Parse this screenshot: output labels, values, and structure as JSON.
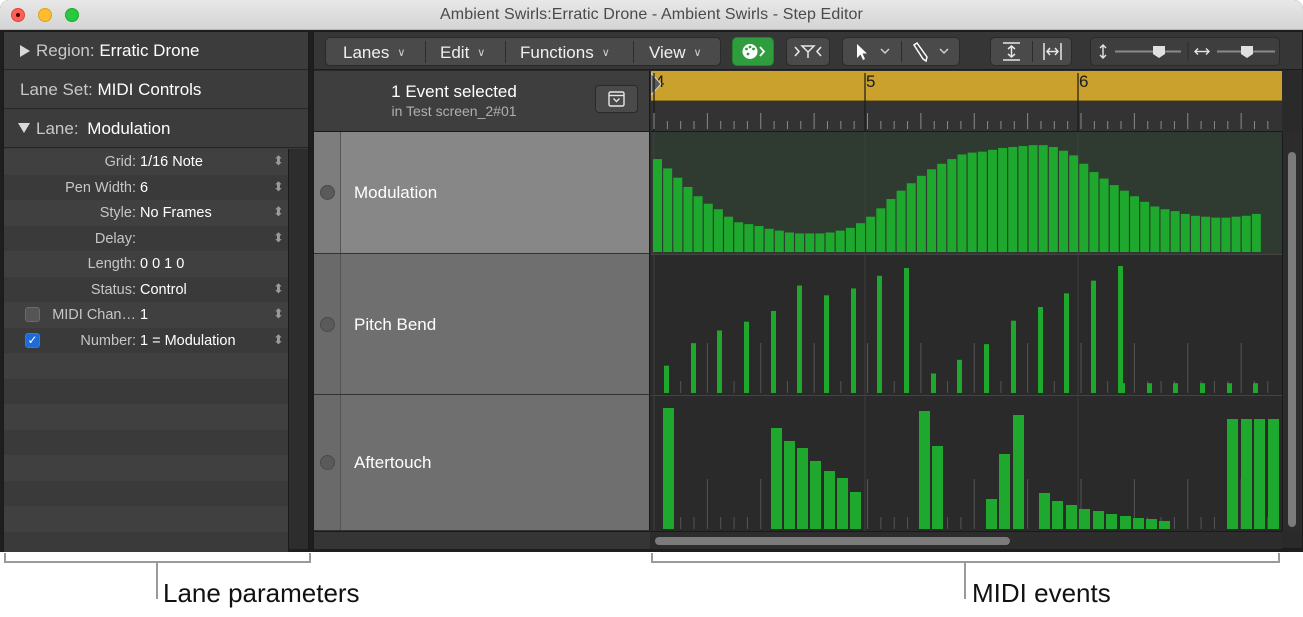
{
  "window": {
    "title": "Ambient Swirls:Erratic Drone - Ambient Swirls - Step Editor"
  },
  "inspector": {
    "region_label": "Region:",
    "region_value": "Erratic Drone",
    "lane_set_label": "Lane Set:",
    "lane_set_value": "MIDI Controls",
    "lane_label": "Lane:",
    "lane_value": "Modulation",
    "params": [
      {
        "label": "Grid:",
        "value": "1/16 Note",
        "stepper": true,
        "checkbox": null
      },
      {
        "label": "Pen Width:",
        "value": "6",
        "stepper": true,
        "checkbox": null
      },
      {
        "label": "Style:",
        "value": "No Frames",
        "stepper": true,
        "checkbox": null
      },
      {
        "label": "Delay:",
        "value": "",
        "stepper": true,
        "checkbox": null
      },
      {
        "label": "Length:",
        "value": "0 0 1      0",
        "stepper": false,
        "checkbox": null
      },
      {
        "label": "Status:",
        "value": "Control",
        "stepper": true,
        "checkbox": null
      },
      {
        "label": "MIDI Chan…",
        "value": "1",
        "stepper": true,
        "checkbox": false
      },
      {
        "label": "Number:",
        "value": "1 = Modulation",
        "stepper": true,
        "checkbox": true
      }
    ]
  },
  "toolbar": {
    "menus": [
      {
        "label": "Lanes"
      },
      {
        "label": "Edit"
      },
      {
        "label": "Functions"
      },
      {
        "label": "View"
      }
    ],
    "icons": [
      "midi-in-icon",
      "catch-icon",
      "pointer-tool-icon",
      "pencil-tool-icon",
      "vertical-zoom-fit-icon",
      "horizontal-zoom-fit-icon",
      "vertical-zoom-icon",
      "horizontal-zoom-icon"
    ]
  },
  "header": {
    "selection_text": "1 Event selected",
    "selection_sub": "in Test screen_2#01"
  },
  "ruler": {
    "bars": [
      "4",
      "5",
      "6"
    ]
  },
  "lanes": [
    {
      "name": "Modulation",
      "values": [
        100,
        90,
        80,
        70,
        60,
        52,
        46,
        38,
        32,
        30,
        28,
        25,
        23,
        21,
        20,
        20,
        20,
        21,
        23,
        26,
        31,
        38,
        47,
        57,
        66,
        74,
        82,
        89,
        95,
        100,
        105,
        107,
        108,
        110,
        112,
        113,
        114,
        115,
        115,
        113,
        109,
        104,
        95,
        86,
        79,
        72,
        66,
        60,
        54,
        49,
        46,
        44,
        41,
        39,
        38,
        37,
        37,
        38,
        39,
        41
      ]
    },
    {
      "name": "Pitch Bend",
      "values": [
        28,
        51,
        64,
        73,
        84,
        110,
        100,
        107,
        120,
        128,
        20,
        34,
        50,
        74,
        88,
        102,
        115,
        130,
        10,
        10,
        10,
        10,
        10,
        10
      ]
    },
    {
      "name": "Aftertouch",
      "values": [
        121,
        101,
        88,
        81,
        68,
        58,
        51,
        37,
        118,
        83,
        30,
        75,
        114,
        36,
        28,
        24,
        20,
        18,
        15,
        13,
        11,
        10,
        8,
        110,
        110,
        110,
        110
      ]
    }
  ],
  "callouts": {
    "left": "Lane parameters",
    "right": "MIDI events"
  },
  "colors": {
    "event_green": "#1fa82e",
    "ruler_gold": "#c9a12c",
    "midi_in_green": "#2f9d3d"
  }
}
